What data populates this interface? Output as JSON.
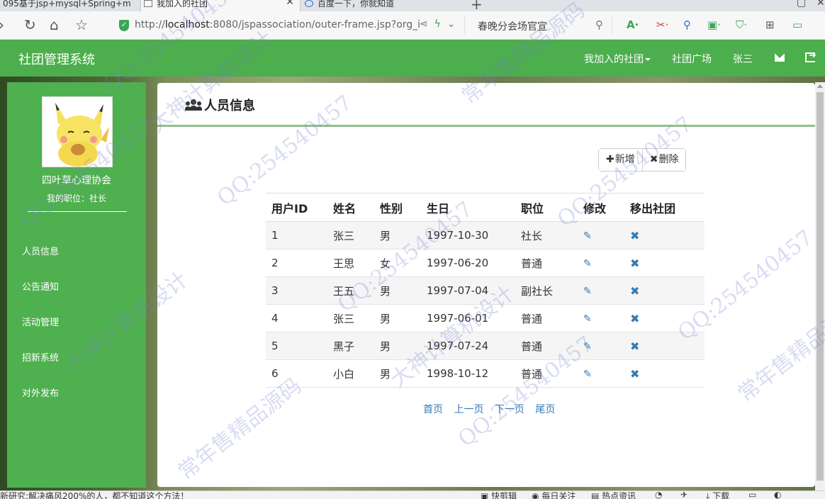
{
  "browser": {
    "tabs": [
      {
        "title": "095基于jsp+mysql+Spring+m"
      },
      {
        "title": "我加入的社团"
      },
      {
        "title": "百度一下，你就知道"
      }
    ],
    "url_prefix": "http://",
    "url_host": "localhost",
    "url_rest": ":8080/jspassociation/outer-frame.jsp?org_i",
    "search_text": "春晚分会场官宣",
    "icons": [
      "back-icon",
      "refresh-icon",
      "home-icon",
      "star-icon",
      "share-icon",
      "bolt-icon",
      "chevron-down-icon",
      "search-icon"
    ]
  },
  "header": {
    "brand": "社团管理系统",
    "nav": {
      "my_clubs": "我加入的社团",
      "plaza": "社团广场",
      "user": "张三"
    }
  },
  "sidebar": {
    "club_name": "四叶草心理协会",
    "position": "我的职位：社长",
    "items": [
      {
        "label": "人员信息"
      },
      {
        "label": "公告通知"
      },
      {
        "label": "活动管理"
      },
      {
        "label": "招新系统"
      },
      {
        "label": "对外发布"
      }
    ]
  },
  "main": {
    "title": "人员信息",
    "add_label": "新增",
    "delete_label": "删除",
    "columns": [
      "用户ID",
      "姓名",
      "性别",
      "生日",
      "职位",
      "修改",
      "移出社团"
    ],
    "rows": [
      {
        "id": "1",
        "name": "张三",
        "gender": "男",
        "birthday": "1997-10-30",
        "role": "社长"
      },
      {
        "id": "2",
        "name": "王思",
        "gender": "女",
        "birthday": "1997-06-20",
        "role": "普通"
      },
      {
        "id": "3",
        "name": "王五",
        "gender": "男",
        "birthday": "1997-07-04",
        "role": "副社长"
      },
      {
        "id": "4",
        "name": "张三",
        "gender": "男",
        "birthday": "1997-06-01",
        "role": "普通"
      },
      {
        "id": "5",
        "name": "黑子",
        "gender": "男",
        "birthday": "1997-07-24",
        "role": "普通"
      },
      {
        "id": "6",
        "name": "小白",
        "gender": "男",
        "birthday": "1998-10-12",
        "role": "普通"
      }
    ],
    "pager": {
      "first": "首页",
      "prev": "上一页",
      "next": "下一页",
      "last": "尾页"
    }
  },
  "statusbar": {
    "news": "新研究:解决痛风200%的人，都不知道这个方法！",
    "item1": "快剪辑",
    "item2": "每日关注",
    "item3": "热点资讯",
    "item4": "下载"
  },
  "watermark": {
    "texts": [
      "QQ:254540457",
      "常年售精品源码",
      "大神计算机设计"
    ]
  },
  "colors": {
    "header_green": "#4cae4c",
    "sidebar_green": "#4fb04f",
    "link_blue": "#337ab7",
    "panel_rule": "#8fc08a"
  }
}
